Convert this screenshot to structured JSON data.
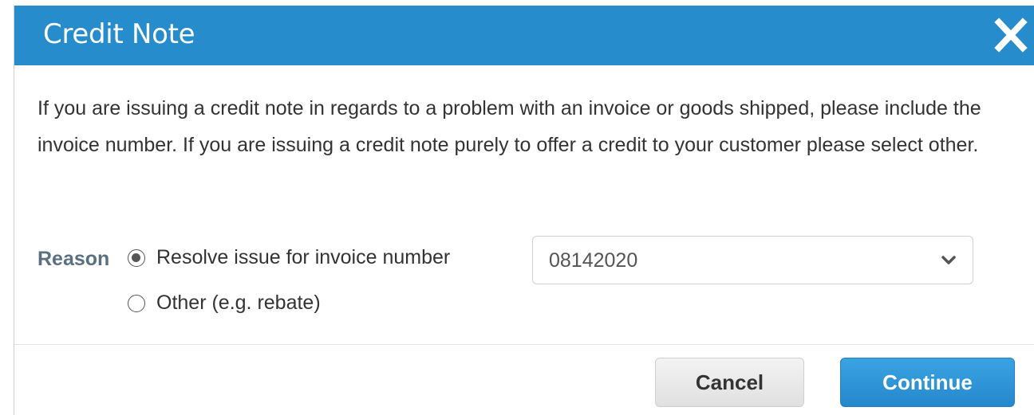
{
  "dialog": {
    "title": "Credit Note",
    "close_icon": "close-icon",
    "description": "If you are issuing a credit note in regards to a problem with an invoice or goods shipped, please include the invoice number. If you are issuing a credit note purely to offer a credit to your customer please select other.",
    "reason_label": "Reason",
    "options": [
      {
        "label": "Resolve issue for invoice number",
        "selected": true
      },
      {
        "label": "Other (e.g. rebate)",
        "selected": false
      }
    ],
    "invoice_select": {
      "value": "08142020",
      "icon": "chevron-down-icon"
    },
    "buttons": {
      "cancel_label": "Cancel",
      "continue_label": "Continue"
    }
  },
  "colors": {
    "header": "#268ccc",
    "primary_button": "#2588cc",
    "reason_label": "#5a6f80"
  }
}
